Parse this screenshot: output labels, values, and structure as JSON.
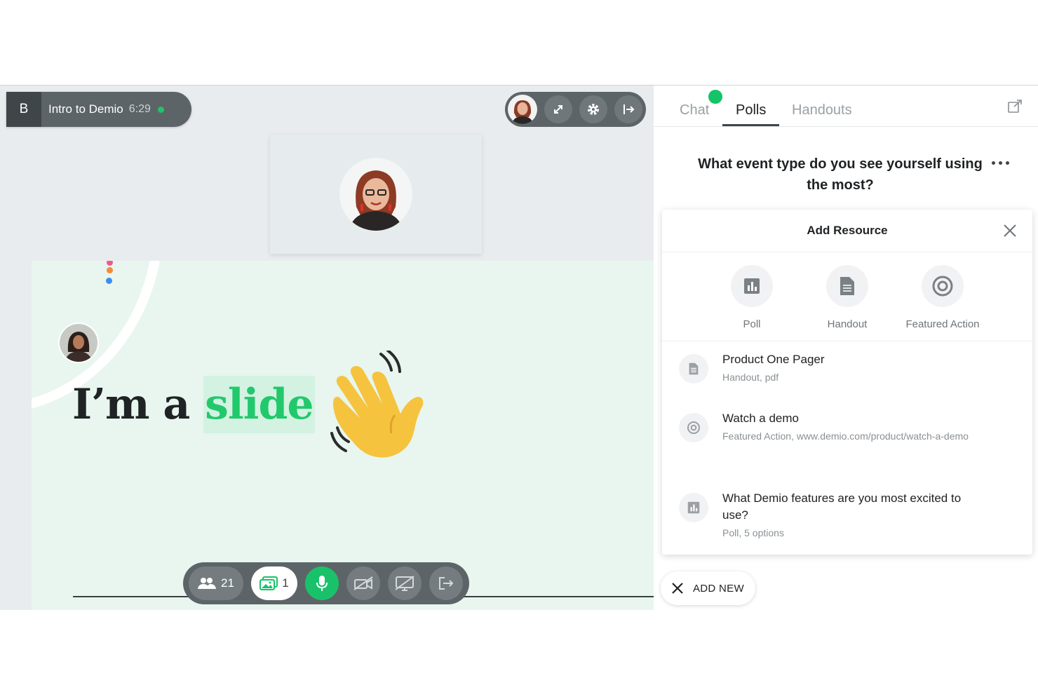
{
  "session": {
    "badge": "B",
    "title": "Intro to Demio",
    "time": "6:29"
  },
  "slide": {
    "text_before": "I’m a ",
    "text_highlight": "slide"
  },
  "bottom_bar": {
    "attendee_count": "21",
    "resource_count": "1"
  },
  "tabs": [
    {
      "label": "Chat"
    },
    {
      "label": "Polls"
    },
    {
      "label": "Handouts"
    }
  ],
  "poll": {
    "question": "What event type do you see yourself using the most?"
  },
  "add_resource": {
    "title": "Add Resource",
    "options": [
      {
        "label": "Poll",
        "icon": "poll-icon"
      },
      {
        "label": "Handout",
        "icon": "document-icon"
      },
      {
        "label": "Featured Action",
        "icon": "target-icon"
      }
    ],
    "items": [
      {
        "title": "Product One Pager",
        "subtitle": "Handout, pdf",
        "icon": "document-icon"
      },
      {
        "title": "Watch a demo",
        "subtitle": "Featured Action, www.demio.com/product/watch-a-demo",
        "icon": "target-icon"
      },
      {
        "title": "What Demio features are you most excited to use?",
        "subtitle": "Poll, 5 options",
        "icon": "poll-icon"
      }
    ]
  },
  "add_new": {
    "label": "ADD NEW"
  },
  "colors": {
    "brand_green": "#19c26a",
    "dark": "#5d6468"
  }
}
